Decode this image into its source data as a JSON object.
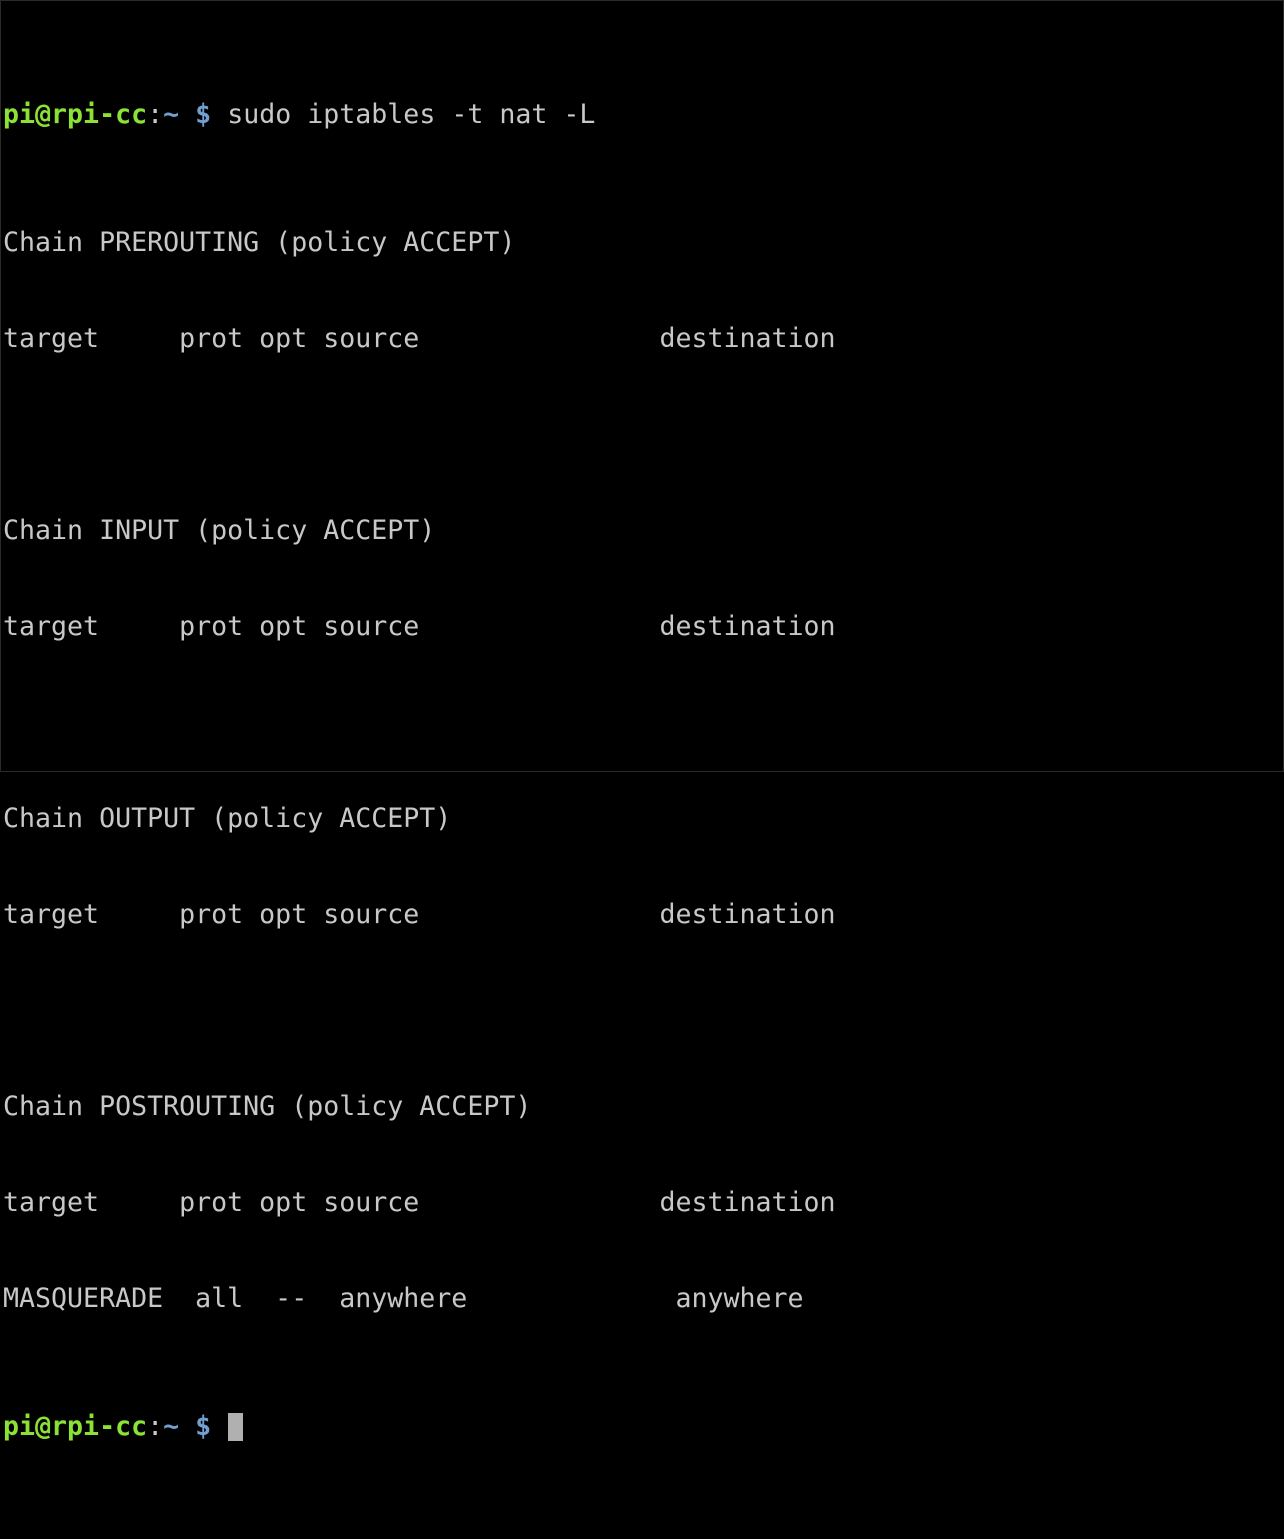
{
  "terminal": {
    "prompt": {
      "user_host": "pi@rpi-cc",
      "colon": ":",
      "cwd": "~",
      "symbol": "$"
    },
    "command": "sudo iptables -t nat -L",
    "output": [
      "Chain PREROUTING (policy ACCEPT)",
      "target     prot opt source               destination",
      "",
      "Chain INPUT (policy ACCEPT)",
      "target     prot opt source               destination",
      "",
      "Chain OUTPUT (policy ACCEPT)",
      "target     prot opt source               destination",
      "",
      "Chain POSTROUTING (policy ACCEPT)",
      "target     prot opt source               destination",
      "MASQUERADE  all  --  anywhere             anywhere"
    ]
  },
  "colors": {
    "background": "#000000",
    "text": "#c8c8c8",
    "user_host": "#8ae234",
    "path": "#729fcf",
    "cursor": "#b0b0b0"
  }
}
